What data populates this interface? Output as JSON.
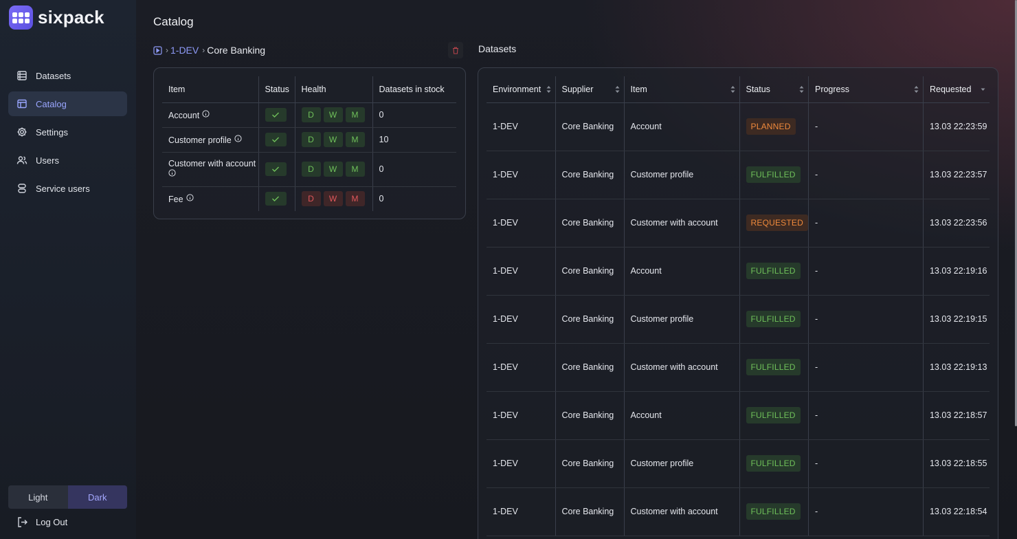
{
  "app": {
    "name": "sixpack"
  },
  "sidebar": {
    "items": [
      {
        "label": "Datasets",
        "icon": "datasets-icon",
        "active": false
      },
      {
        "label": "Catalog",
        "icon": "catalog-icon",
        "active": true
      },
      {
        "label": "Settings",
        "icon": "gear-icon",
        "active": false
      },
      {
        "label": "Users",
        "icon": "users-icon",
        "active": false
      },
      {
        "label": "Service users",
        "icon": "service-users-icon",
        "active": false
      }
    ],
    "theme": {
      "light": "Light",
      "dark": "Dark",
      "selected": "Dark"
    },
    "logout": "Log Out"
  },
  "page": {
    "title": "Catalog"
  },
  "breadcrumb": {
    "env": "1-DEV",
    "current": "Core Banking"
  },
  "catalog": {
    "columns": [
      "Item",
      "Status",
      "Health",
      "Datasets in stock"
    ],
    "rows": [
      {
        "item": "Account",
        "health": [
          "D",
          "W",
          "M"
        ],
        "health_state": "ok",
        "stock": "0"
      },
      {
        "item": "Customer profile",
        "health": [
          "D",
          "W",
          "M"
        ],
        "health_state": "ok",
        "stock": "10"
      },
      {
        "item": "Customer with account",
        "health": [
          "D",
          "W",
          "M"
        ],
        "health_state": "ok",
        "stock": "0"
      },
      {
        "item": "Fee",
        "health": [
          "D",
          "W",
          "M"
        ],
        "health_state": "bad",
        "stock": "0"
      }
    ]
  },
  "datasets": {
    "title": "Datasets",
    "columns": [
      "Environment",
      "Supplier",
      "Item",
      "Status",
      "Progress",
      "Requested"
    ],
    "rows": [
      {
        "env": "1-DEV",
        "supplier": "Core Banking",
        "item": "Account",
        "status": "PLANNED",
        "progress": "-",
        "requested": "13.03 22:23:59"
      },
      {
        "env": "1-DEV",
        "supplier": "Core Banking",
        "item": "Customer profile",
        "status": "FULFILLED",
        "progress": "-",
        "requested": "13.03 22:23:57"
      },
      {
        "env": "1-DEV",
        "supplier": "Core Banking",
        "item": "Customer with account",
        "status": "REQUESTED",
        "progress": "-",
        "requested": "13.03 22:23:56"
      },
      {
        "env": "1-DEV",
        "supplier": "Core Banking",
        "item": "Account",
        "status": "FULFILLED",
        "progress": "-",
        "requested": "13.03 22:19:16"
      },
      {
        "env": "1-DEV",
        "supplier": "Core Banking",
        "item": "Customer profile",
        "status": "FULFILLED",
        "progress": "-",
        "requested": "13.03 22:19:15"
      },
      {
        "env": "1-DEV",
        "supplier": "Core Banking",
        "item": "Customer with account",
        "status": "FULFILLED",
        "progress": "-",
        "requested": "13.03 22:19:13"
      },
      {
        "env": "1-DEV",
        "supplier": "Core Banking",
        "item": "Account",
        "status": "FULFILLED",
        "progress": "-",
        "requested": "13.03 22:18:57"
      },
      {
        "env": "1-DEV",
        "supplier": "Core Banking",
        "item": "Customer profile",
        "status": "FULFILLED",
        "progress": "-",
        "requested": "13.03 22:18:55"
      },
      {
        "env": "1-DEV",
        "supplier": "Core Banking",
        "item": "Customer with account",
        "status": "FULFILLED",
        "progress": "-",
        "requested": "13.03 22:18:54"
      }
    ]
  },
  "colors": {
    "accent": "#9aa6ff",
    "ok": "#6fc05a",
    "bad": "#e0575b",
    "warn": "#f08a3c"
  }
}
